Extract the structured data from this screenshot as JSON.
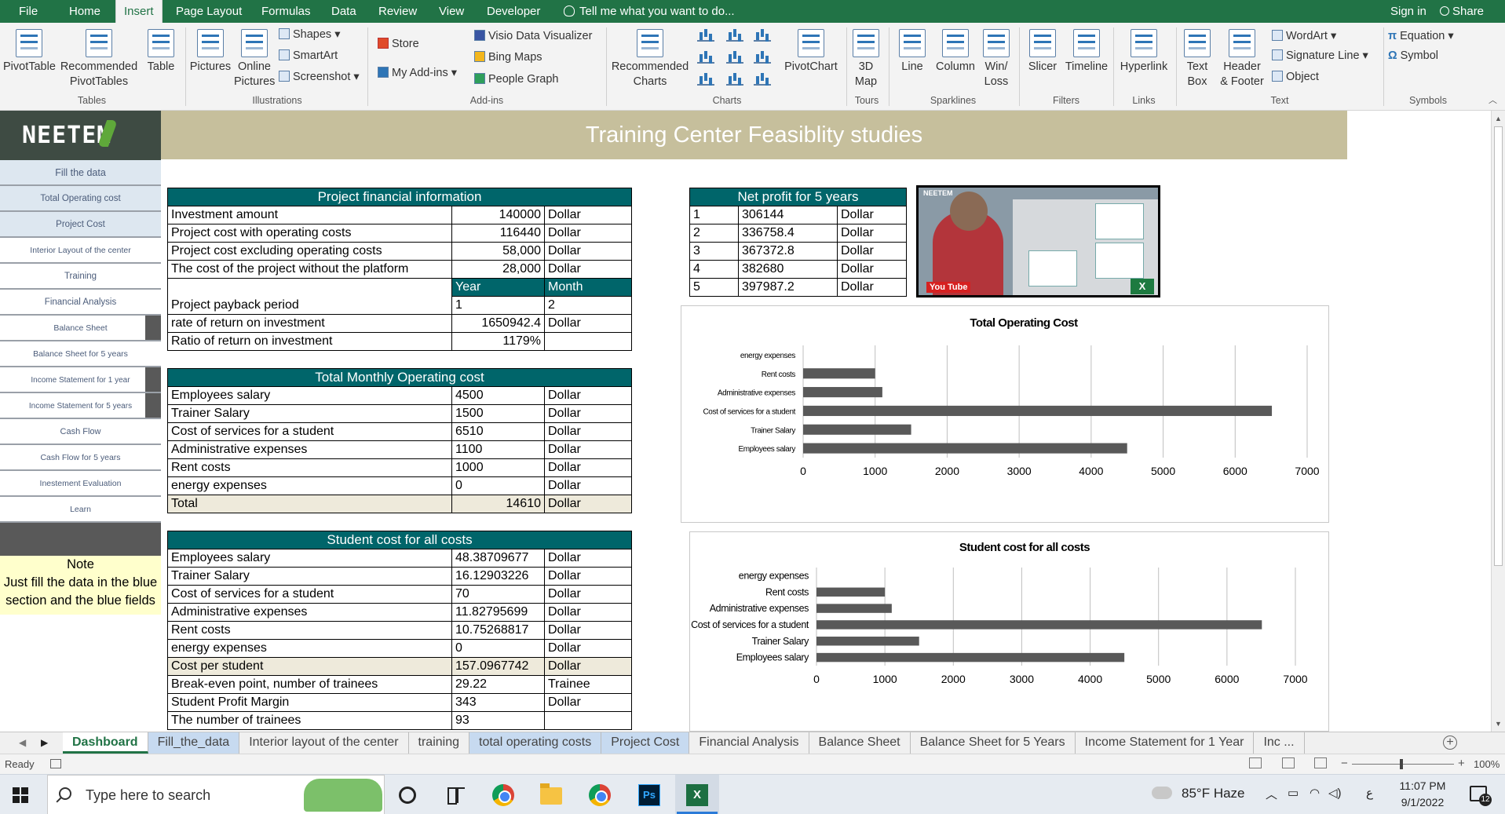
{
  "ribbon_tabs": [
    "File",
    "Home",
    "Insert",
    "Page Layout",
    "Formulas",
    "Data",
    "Review",
    "View",
    "Developer"
  ],
  "active_tab": "Insert",
  "tell_me": "Tell me what you want to do...",
  "sign_in": "Sign in",
  "share": "Share",
  "ribbon": {
    "pivot_table": "PivotTable",
    "recommended_pivot": [
      "Recommended",
      "PivotTables"
    ],
    "table": "Table",
    "pictures": "Pictures",
    "online_pictures": [
      "Online",
      "Pictures"
    ],
    "shapes": "Shapes",
    "smartart": "SmartArt",
    "screenshot": "Screenshot",
    "store": "Store",
    "my_addins": "My Add-ins",
    "visio": "Visio Data Visualizer",
    "bing_maps": "Bing Maps",
    "people_graph": "People Graph",
    "recommended_charts": [
      "Recommended",
      "Charts"
    ],
    "pivot_chart": "PivotChart",
    "map3d": [
      "3D",
      "Map"
    ],
    "line": "Line",
    "column": "Column",
    "winloss": [
      "Win/",
      "Loss"
    ],
    "slicer": "Slicer",
    "timeline": "Timeline",
    "hyperlink": "Hyperlink",
    "text_box": [
      "Text",
      "Box"
    ],
    "header_footer": [
      "Header",
      "& Footer"
    ],
    "wordart": "WordArt",
    "signature": "Signature Line",
    "object": "Object",
    "equation": "Equation",
    "symbol": "Symbol",
    "groups": [
      "Tables",
      "Illustrations",
      "Add-ins",
      "Charts",
      "Tours",
      "Sparklines",
      "Filters",
      "Links",
      "Text",
      "Symbols"
    ]
  },
  "banner_title": "Training Center Feasiblity studies",
  "logo_text": "NEETEM",
  "left_nav": [
    "Fill the data",
    "Total Operating cost",
    "Project Cost",
    "Interior Layout of the center",
    "Training",
    "Financial Analysis",
    "Balance Sheet",
    "Balance Sheet for 5 years",
    "Income Statement for 1 year",
    "Income Statement for 5 years",
    "Cash Flow",
    "Cash Flow for 5 years",
    "Inestement Evaluation",
    "Learn"
  ],
  "note": {
    "title": "Note",
    "body": "Just fill the data in the blue section and the blue fields"
  },
  "project_fin": {
    "header": "Project financial information",
    "rows": [
      {
        "label": "Investment amount",
        "value": "140000",
        "unit": "Dollar"
      },
      {
        "label": "Project cost with operating costs",
        "value": "116440",
        "unit": "Dollar"
      },
      {
        "label": "Project cost excluding operating costs",
        "value": "58,000",
        "unit": "Dollar"
      },
      {
        "label": "The cost of the project without the platform",
        "value": "28,000",
        "unit": "Dollar"
      }
    ],
    "year_label": "Year",
    "month_label": "Month",
    "payback_label": "Project payback period",
    "payback_year": "1",
    "payback_month": "2",
    "ror_label": "rate of return on investment",
    "ror_value": "1650942.4",
    "ror_unit": "Dollar",
    "ratio_label": "Ratio of return on investment",
    "ratio_value": "1179%"
  },
  "net_profit": {
    "header": "Net profit for 5 years",
    "rows": [
      {
        "year": "1",
        "value": "306144",
        "unit": "Dollar"
      },
      {
        "year": "2",
        "value": "336758.4",
        "unit": "Dollar"
      },
      {
        "year": "3",
        "value": "367372.8",
        "unit": "Dollar"
      },
      {
        "year": "4",
        "value": "382680",
        "unit": "Dollar"
      },
      {
        "year": "5",
        "value": "397987.2",
        "unit": "Dollar"
      }
    ]
  },
  "thumbnail": {
    "logo": "NEETEM",
    "youtube": "You Tube",
    "excel": "X"
  },
  "monthly_cost": {
    "header": "Total Monthly Operating cost",
    "rows": [
      {
        "label": "Employees salary",
        "value": "4500",
        "unit": "Dollar"
      },
      {
        "label": "Trainer Salary",
        "value": "1500",
        "unit": "Dollar"
      },
      {
        "label": "Cost of services for a student",
        "value": "6510",
        "unit": "Dollar"
      },
      {
        "label": "Administrative expenses",
        "value": "1100",
        "unit": "Dollar"
      },
      {
        "label": "Rent costs",
        "value": "1000",
        "unit": "Dollar"
      },
      {
        "label": "energy expenses",
        "value": "0",
        "unit": "Dollar"
      }
    ],
    "total_label": "Total",
    "total_value": "14610",
    "total_unit": "Dollar"
  },
  "student_cost": {
    "header": "Student cost for all costs",
    "rows": [
      {
        "label": "Employees salary",
        "value": "48.38709677",
        "unit": "Dollar"
      },
      {
        "label": "Trainer Salary",
        "value": "16.12903226",
        "unit": "Dollar"
      },
      {
        "label": "Cost of services for a student",
        "value": "70",
        "unit": "Dollar"
      },
      {
        "label": "Administrative expenses",
        "value": "11.82795699",
        "unit": "Dollar"
      },
      {
        "label": "Rent costs",
        "value": "10.75268817",
        "unit": "Dollar"
      },
      {
        "label": "energy expenses",
        "value": "0",
        "unit": "Dollar"
      }
    ],
    "per_student_label": "Cost per student",
    "per_student_value": "157.0967742",
    "per_student_unit": "Dollar",
    "breakeven_label": "Break-even point, number of trainees",
    "breakeven_value": "29.22",
    "breakeven_unit": "Trainee",
    "margin_label": "Student Profit Margin",
    "margin_value": "343",
    "margin_unit": "Dollar",
    "trainees_label": "The number of trainees",
    "trainees_value": "93"
  },
  "chart_data": [
    {
      "type": "bar",
      "orientation": "horizontal",
      "title": "Total Operating Cost",
      "categories": [
        "energy expenses",
        "Rent costs",
        "Administrative expenses",
        "Cost of services for a student",
        "Trainer Salary",
        "Employees salary"
      ],
      "values": [
        0,
        1000,
        1100,
        6510,
        1500,
        4500
      ],
      "xlim": [
        0,
        7000
      ],
      "ticks": [
        "0",
        "1000",
        "2000",
        "3000",
        "4000",
        "5000",
        "6000",
        "7000"
      ],
      "grid": true,
      "bar_color": "#595959"
    },
    {
      "type": "bar",
      "orientation": "horizontal",
      "title": "Student cost for all costs",
      "categories": [
        "energy expenses",
        "Rent costs",
        "Administrative expenses",
        "Cost of services for a student",
        "Trainer Salary",
        "Employees salary"
      ],
      "values": [
        0,
        1000,
        1100,
        6510,
        1500,
        4500
      ],
      "xlim": [
        0,
        7000
      ],
      "ticks": [
        "0",
        "1000",
        "2000",
        "3000",
        "4000",
        "5000",
        "6000",
        "7000"
      ],
      "grid": true,
      "bar_color": "#595959"
    }
  ],
  "sheet_tabs": [
    {
      "label": "Dashboard",
      "state": "active"
    },
    {
      "label": "Fill_the_data",
      "state": "blue"
    },
    {
      "label": "Interior layout of the center",
      "state": "plain"
    },
    {
      "label": "training",
      "state": "plain"
    },
    {
      "label": "total operating costs",
      "state": "blue"
    },
    {
      "label": "Project Cost",
      "state": "blue"
    },
    {
      "label": "Financial Analysis",
      "state": "plain"
    },
    {
      "label": "Balance Sheet",
      "state": "plain"
    },
    {
      "label": "Balance Sheet for 5 Years",
      "state": "plain"
    },
    {
      "label": "Income Statement for 1 Year",
      "state": "plain"
    },
    {
      "label": "Inc ...",
      "state": "plain"
    }
  ],
  "status": {
    "ready": "Ready",
    "zoom": "100%"
  },
  "taskbar": {
    "search_placeholder": "Type here to search",
    "weather": "85°F  Haze",
    "lang": "ع",
    "time": "11:07 PM",
    "date": "9/1/2022",
    "notif_count": "12"
  }
}
